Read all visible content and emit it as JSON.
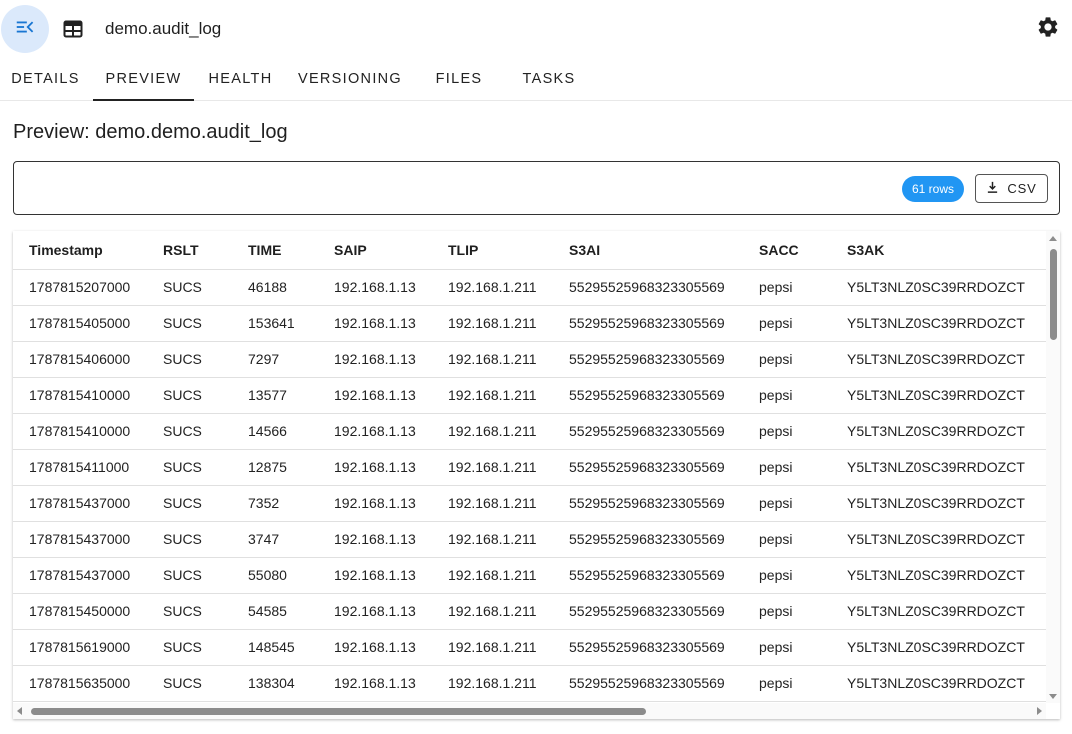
{
  "header": {
    "title": "demo.audit_log",
    "icons": {
      "menu": "menu-collapse-icon",
      "table": "table-icon",
      "settings": "gear-icon"
    },
    "colors": {
      "menu_bg": "#dbe9fb",
      "accent": "#1976d2"
    }
  },
  "tabs": [
    {
      "label": "DETAILS",
      "active": false
    },
    {
      "label": "PREVIEW",
      "active": true
    },
    {
      "label": "HEALTH",
      "active": false
    },
    {
      "label": "VERSIONING",
      "active": false
    },
    {
      "label": "FILES",
      "active": false
    },
    {
      "label": "TASKS",
      "active": false
    }
  ],
  "preview": {
    "heading": "Preview: demo.demo.audit_log",
    "rows_badge": "61 rows",
    "csv_label": "CSV",
    "badge_color": "#2196f3"
  },
  "table": {
    "columns": [
      "Timestamp",
      "RSLT",
      "TIME",
      "SAIP",
      "TLIP",
      "S3AI",
      "SACC",
      "S3AK"
    ],
    "rows": [
      [
        "1787815207000",
        "SUCS",
        "46188",
        "192.168.1.13",
        "192.168.1.211",
        "55295525968323305569",
        "pepsi",
        "Y5LT3NLZ0SC39RRDOZCT"
      ],
      [
        "1787815405000",
        "SUCS",
        "153641",
        "192.168.1.13",
        "192.168.1.211",
        "55295525968323305569",
        "pepsi",
        "Y5LT3NLZ0SC39RRDOZCT"
      ],
      [
        "1787815406000",
        "SUCS",
        "7297",
        "192.168.1.13",
        "192.168.1.211",
        "55295525968323305569",
        "pepsi",
        "Y5LT3NLZ0SC39RRDOZCT"
      ],
      [
        "1787815410000",
        "SUCS",
        "13577",
        "192.168.1.13",
        "192.168.1.211",
        "55295525968323305569",
        "pepsi",
        "Y5LT3NLZ0SC39RRDOZCT"
      ],
      [
        "1787815410000",
        "SUCS",
        "14566",
        "192.168.1.13",
        "192.168.1.211",
        "55295525968323305569",
        "pepsi",
        "Y5LT3NLZ0SC39RRDOZCT"
      ],
      [
        "1787815411000",
        "SUCS",
        "12875",
        "192.168.1.13",
        "192.168.1.211",
        "55295525968323305569",
        "pepsi",
        "Y5LT3NLZ0SC39RRDOZCT"
      ],
      [
        "1787815437000",
        "SUCS",
        "7352",
        "192.168.1.13",
        "192.168.1.211",
        "55295525968323305569",
        "pepsi",
        "Y5LT3NLZ0SC39RRDOZCT"
      ],
      [
        "1787815437000",
        "SUCS",
        "3747",
        "192.168.1.13",
        "192.168.1.211",
        "55295525968323305569",
        "pepsi",
        "Y5LT3NLZ0SC39RRDOZCT"
      ],
      [
        "1787815437000",
        "SUCS",
        "55080",
        "192.168.1.13",
        "192.168.1.211",
        "55295525968323305569",
        "pepsi",
        "Y5LT3NLZ0SC39RRDOZCT"
      ],
      [
        "1787815450000",
        "SUCS",
        "54585",
        "192.168.1.13",
        "192.168.1.211",
        "55295525968323305569",
        "pepsi",
        "Y5LT3NLZ0SC39RRDOZCT"
      ],
      [
        "1787815619000",
        "SUCS",
        "148545",
        "192.168.1.13",
        "192.168.1.211",
        "55295525968323305569",
        "pepsi",
        "Y5LT3NLZ0SC39RRDOZCT"
      ],
      [
        "1787815635000",
        "SUCS",
        "138304",
        "192.168.1.13",
        "192.168.1.211",
        "55295525968323305569",
        "pepsi",
        "Y5LT3NLZ0SC39RRDOZCT"
      ]
    ]
  }
}
